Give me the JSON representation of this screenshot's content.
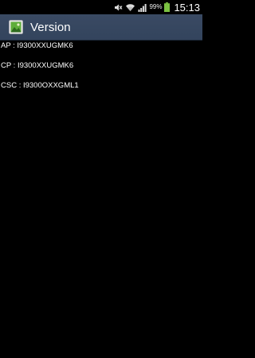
{
  "status_bar": {
    "icons": [
      "mute-icon",
      "wifi-icon",
      "signal-icon",
      "battery-icon"
    ],
    "battery_percent": "99%",
    "time": "15:13",
    "battery_color": "#7cc242"
  },
  "action_bar": {
    "title": "Version",
    "icon": "app-icon",
    "background": "#3a4a63"
  },
  "versions": [
    {
      "label": "AP : I9300XXUGMK6"
    },
    {
      "label": "CP : I9300XXUGMK6"
    },
    {
      "label": "CSC : I9300OXXGML1"
    }
  ]
}
